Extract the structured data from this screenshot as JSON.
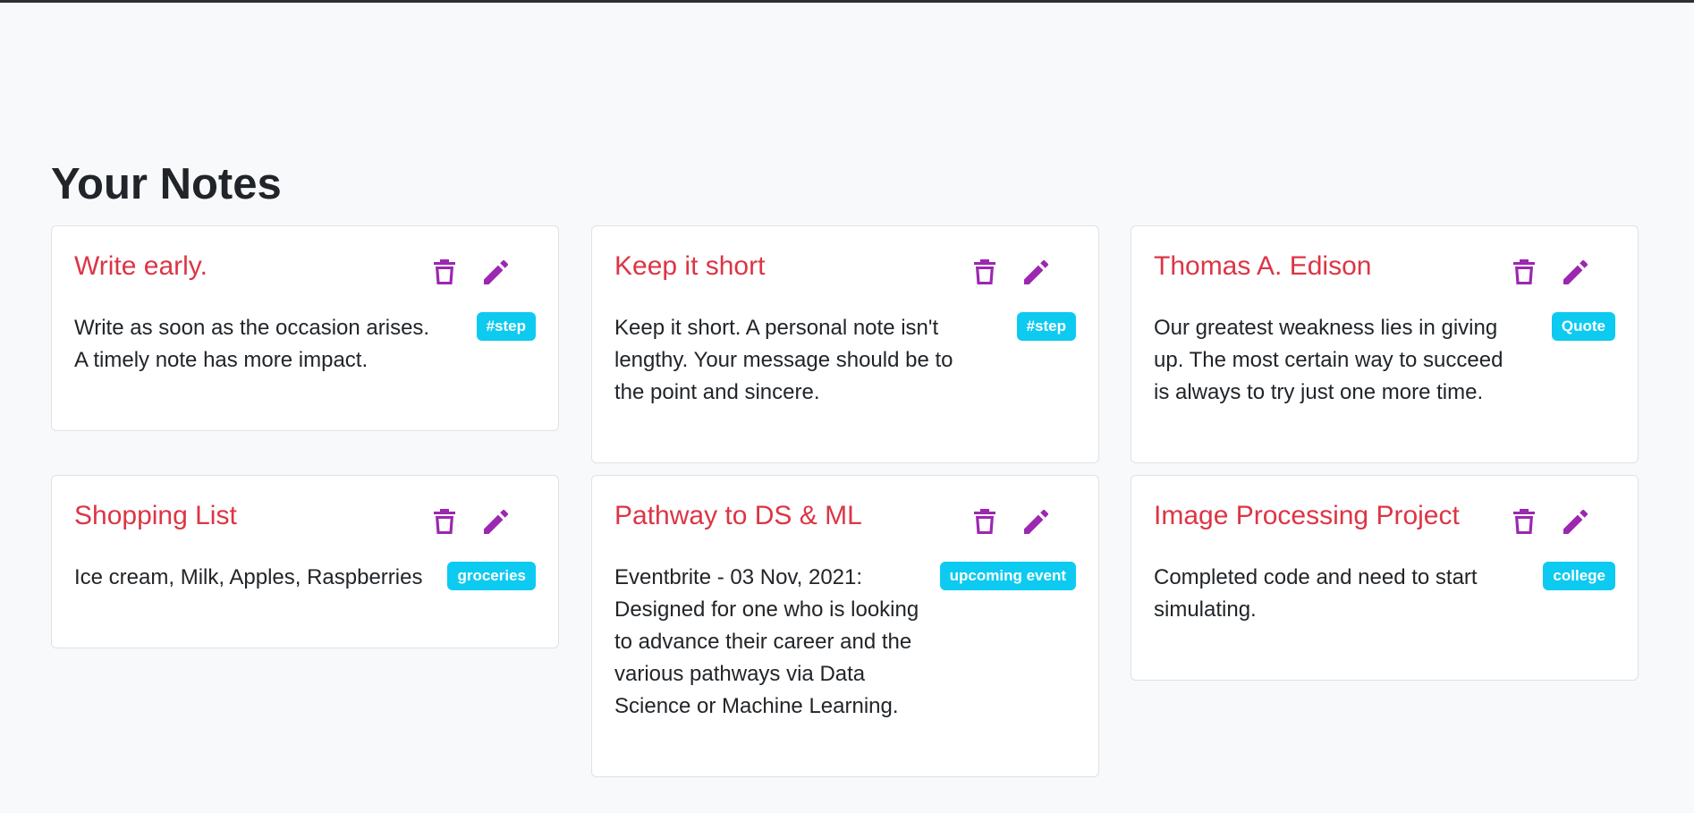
{
  "page": {
    "title": "Your Notes"
  },
  "colors": {
    "title": "#dc3545",
    "icon": "#9c27b0",
    "badge": "#0dcaf0"
  },
  "icons": {
    "delete": "trash-icon",
    "edit": "pencil-icon"
  },
  "notes": [
    {
      "title": "Write early.",
      "description": "Write as soon as the occasion arises. A timely note has more impact.",
      "tag": "#step"
    },
    {
      "title": "Keep it short",
      "description": "Keep it short. A personal note isn't lengthy. Your message should be to the point and sincere.",
      "tag": "#step"
    },
    {
      "title": "Thomas A. Edison",
      "description": "Our greatest weakness lies in giving up. The most certain way to succeed is always to try just one more time.",
      "tag": "Quote"
    },
    {
      "title": "Shopping List",
      "description": "Ice cream, Milk, Apples, Raspberries",
      "tag": "groceries"
    },
    {
      "title": "Pathway to DS & ML",
      "description": "Eventbrite - 03 Nov, 2021: Designed for one who is looking to advance their career and the various pathways via Data Science or Machine Learning.",
      "tag": "upcoming event"
    },
    {
      "title": "Image Processing Project",
      "description": "Completed code and need to start simulating.",
      "tag": "college"
    }
  ]
}
